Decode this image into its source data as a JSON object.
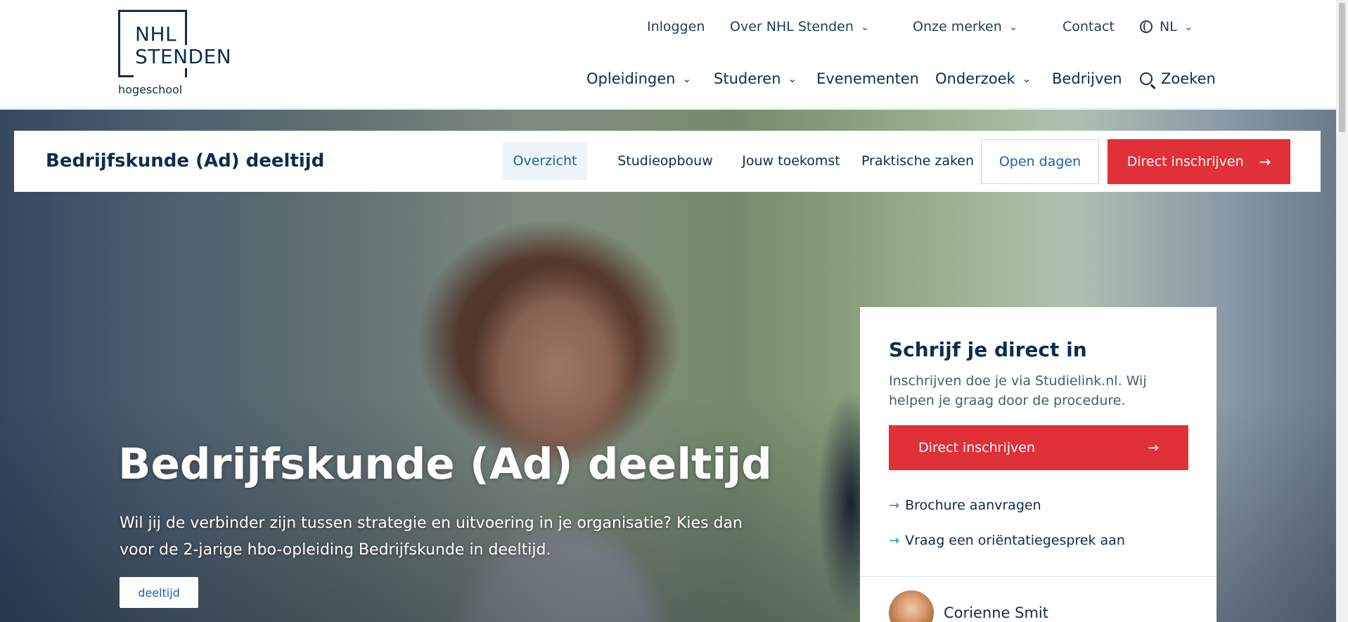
{
  "logo": {
    "line1": "NHL",
    "line2": "STENDEN",
    "sub": "hogeschool"
  },
  "topnav": {
    "login": "Inloggen",
    "about": "Over NHL Stenden",
    "brands": "Onze merken",
    "contact": "Contact",
    "language": "NL"
  },
  "mainnav": {
    "programs": "Opleidingen",
    "study": "Studeren",
    "events": "Evenementen",
    "research": "Onderzoek",
    "business": "Bedrijven",
    "search": "Zoeken"
  },
  "subnav": {
    "title": "Bedrijfskunde (Ad) deeltijd",
    "tabs": [
      "Overzicht",
      "Studieopbouw",
      "Jouw toekomst",
      "Praktische zaken"
    ],
    "open_days": "Open dagen",
    "enroll": "Direct inschrijven"
  },
  "hero": {
    "title": "Bedrijfskunde (Ad) deeltijd",
    "intro": "Wil jij de verbinder zijn tussen strategie en uitvoering in je organisatie? Kies dan voor de 2-jarige hbo-opleiding Bedrijfskunde in deeltijd.",
    "badge": "deeltijd"
  },
  "card": {
    "title": "Schrijf je direct in",
    "text": "Inschrijven doe je via Studielink.nl. Wij helpen je graag door de procedure.",
    "button": "Direct inschrijven",
    "link1": "Brochure aanvragen",
    "link2": "Vraag een oriëntatiegesprek aan",
    "contact_name": "Corienne Smit"
  },
  "colors": {
    "primary": "#0e2d4d",
    "accent_red": "#e03138",
    "link_blue": "#1e5fa8",
    "arrow_blue": "#1c8fd6"
  },
  "icons": [
    "chevron-down-icon",
    "globe-icon",
    "search-icon",
    "arrow-right-icon"
  ]
}
